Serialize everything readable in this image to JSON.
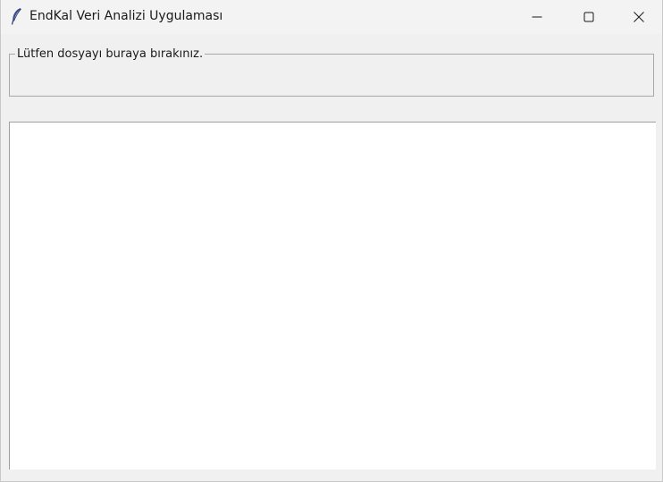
{
  "window": {
    "title": "EndKal Veri Analizi Uygulaması",
    "app_icon": "feather-icon",
    "controls": {
      "minimize_icon": "minimize-icon",
      "maximize_icon": "maximize-icon",
      "close_icon": "close-icon"
    }
  },
  "drop_zone": {
    "label": "Lütfen dosyayı buraya bırakınız."
  },
  "output": {
    "value": ""
  }
}
